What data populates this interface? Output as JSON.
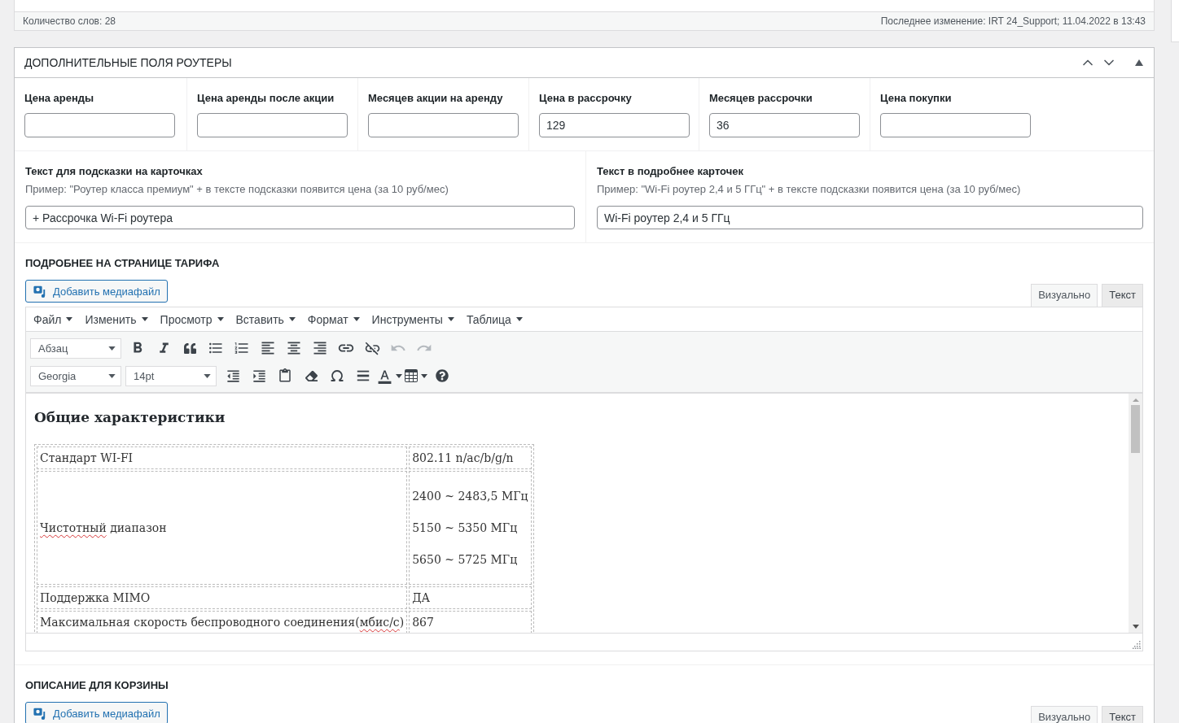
{
  "previous_editor": {
    "word_count": "Количество слов: 28",
    "last_modified": "Последнее изменение: IRT 24_Support; 11.04.2022 в 13:43"
  },
  "metabox": {
    "title": "ДОПОЛНИТЕЛЬНЫЕ ПОЛЯ РОУТЕРЫ",
    "expanded": true,
    "price_fields": [
      {
        "label": "Цена аренды"
      },
      {
        "label": "Цена аренды после акции"
      },
      {
        "label": "Месяцев акции на аренду"
      },
      {
        "label": "Цена в рассрочку",
        "value": "129"
      },
      {
        "label": "Месяцев рассрочки",
        "value": "36"
      },
      {
        "label": "Цена покупки"
      }
    ],
    "text_fields": [
      {
        "label": "Текст для подсказки на карточках",
        "description": "Пример: \"Роутер класса премиум\" + в тексте подсказки появится цена (за 10 руб/мес)",
        "value": "+ Рассрочка Wi-Fi роутера"
      },
      {
        "label": "Текст в подробнее карточек",
        "description": "Пример: \"Wi-Fi роутер 2,4 и 5 ГГц\" + в тексте подсказки появится цена (за 10 руб/мес)",
        "value": "Wi-Fi роутер 2,4 и 5 ГГц"
      }
    ],
    "editors": [
      {
        "title": "ПОДРОБНЕЕ НА СТРАНИЦЕ ТАРИФА",
        "media_button": "Добавить медиафайл",
        "tabs": [
          {
            "label": "Визуально",
            "selected": true
          },
          {
            "label": "Текст",
            "selected": false
          }
        ],
        "menu": [
          "Файл",
          "Изменить",
          "Просмотр",
          "Вставить",
          "Формат",
          "Инструменты",
          "Таблица"
        ],
        "toolbar_rows": [
          [
            {
              "kind": "format_select",
              "value": "Абзац",
              "disabled": false
            },
            {
              "kind": "bold",
              "disabled": false
            },
            {
              "kind": "italic",
              "disabled": false
            },
            {
              "kind": "blockquote",
              "disabled": false
            },
            {
              "kind": "bullet_list",
              "disabled": false
            },
            {
              "kind": "numbered_list",
              "disabled": false
            },
            {
              "kind": "align_left",
              "disabled": false
            },
            {
              "kind": "align_center",
              "disabled": false
            },
            {
              "kind": "align_right",
              "disabled": false
            },
            {
              "kind": "link",
              "disabled": false
            },
            {
              "kind": "unlink",
              "disabled": false
            },
            {
              "kind": "undo",
              "disabled": true
            },
            {
              "kind": "redo",
              "disabled": true
            }
          ],
          [
            {
              "kind": "font_select",
              "value": "Georgia",
              "disabled": false
            },
            {
              "kind": "size_select",
              "value": "14pt",
              "disabled": false
            },
            {
              "kind": "outdent",
              "disabled": false
            },
            {
              "kind": "indent",
              "disabled": false
            },
            {
              "kind": "paste_text",
              "disabled": false
            },
            {
              "kind": "clear_format",
              "disabled": false
            },
            {
              "kind": "special_char",
              "disabled": false
            },
            {
              "kind": "horizontal_line",
              "disabled": false
            },
            {
              "kind": "text_color",
              "disabled": false
            },
            {
              "kind": "table",
              "disabled": false
            },
            {
              "kind": "help",
              "disabled": false
            }
          ]
        ],
        "content": {
          "heading": "Общие характеристики",
          "table": {
            "rows": [
              {
                "name": [
                  {
                    "text": "Стандарт WI-FI",
                    "misspelled": false
                  }
                ],
                "value": [
                  "802.11 n/ac/b/g/n"
                ]
              },
              {
                "name": [
                  {
                    "text": "Чистотный",
                    "misspelled": true
                  },
                  {
                    "text": " диапазон",
                    "misspelled": false
                  }
                ],
                "value": [
                  "2400 ~ 2483,5 МГц",
                  "5150 ~ 5350 МГц",
                  "5650 ~ 5725 МГц"
                ]
              },
              {
                "name": [
                  {
                    "text": "Поддержка MIMO",
                    "misspelled": false
                  }
                ],
                "value": [
                  "ДА"
                ]
              },
              {
                "name": [
                  {
                    "text": "Максимальная скорость беспроводного соединения(",
                    "misspelled": false
                  },
                  {
                    "text": "мбис/с",
                    "misspelled": true
                  },
                  {
                    "text": ")",
                    "misspelled": false
                  }
                ],
                "value": [
                  "867"
                ]
              }
            ]
          }
        }
      },
      {
        "title": "ОПИСАНИЕ ДЛЯ КОРЗИНЫ",
        "media_button": "Добавить медиафайл",
        "tabs": [
          {
            "label": "Визуально",
            "selected": true
          },
          {
            "label": "Текст",
            "selected": false
          }
        ]
      }
    ]
  }
}
